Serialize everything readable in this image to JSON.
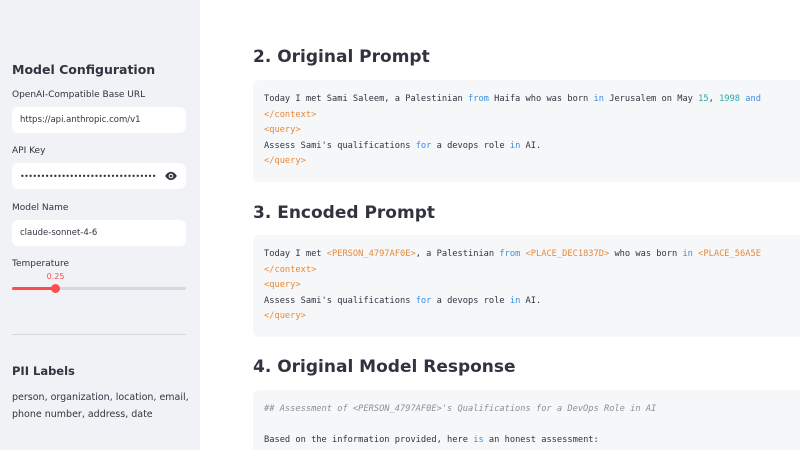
{
  "sidebar": {
    "heading": "Model Configuration",
    "base_url_label": "OpenAI-Compatible Base URL",
    "base_url_value": "https://api.anthropic.com/v1",
    "api_key_label": "API Key",
    "api_key_value": "••••••••••••••••••••••••••••••••••••••••••••••••••••",
    "model_label": "Model Name",
    "model_value": "claude-sonnet-4-6",
    "temperature_label": "Temperature",
    "temperature_value": "0.25",
    "temperature_fraction": 0.25,
    "pii_heading": "PII Labels",
    "pii_text": "person, organization, location, email, phone number, address, date",
    "accent_color": "#ff4b4b"
  },
  "main": {
    "original_prompt": {
      "title": "2. Original Prompt",
      "lines": [
        [
          {
            "t": "Today I met Sami Saleem, a Palestinian "
          },
          {
            "t": "from",
            "c": "kw"
          },
          {
            "t": " Haifa who was born "
          },
          {
            "t": "in",
            "c": "kw"
          },
          {
            "t": " Jerusalem on May "
          },
          {
            "t": "15",
            "c": "num"
          },
          {
            "t": ", "
          },
          {
            "t": "1998",
            "c": "num"
          },
          {
            "t": " and",
            "c": "kw"
          }
        ],
        [
          {
            "t": "</context>",
            "c": "tag"
          }
        ],
        [
          {
            "t": "<query>",
            "c": "tag"
          }
        ],
        [
          {
            "t": "Assess Sami's qualifications "
          },
          {
            "t": "for",
            "c": "kw"
          },
          {
            "t": " a devops role "
          },
          {
            "t": "in",
            "c": "kw"
          },
          {
            "t": " AI."
          }
        ],
        [
          {
            "t": "</query>",
            "c": "tag"
          }
        ]
      ]
    },
    "encoded_prompt": {
      "title": "3. Encoded Prompt",
      "lines": [
        [
          {
            "t": "Today I met "
          },
          {
            "t": "<PERSON_4797AF0E>",
            "c": "tag"
          },
          {
            "t": ", a Palestinian "
          },
          {
            "t": "from",
            "c": "kw"
          },
          {
            "t": " "
          },
          {
            "t": "<PLACE_DEC1837D>",
            "c": "tag"
          },
          {
            "t": " who was born "
          },
          {
            "t": "in",
            "c": "kw"
          },
          {
            "t": " "
          },
          {
            "t": "<PLACE_56A5E",
            "c": "tag"
          }
        ],
        [
          {
            "t": "</context>",
            "c": "tag"
          }
        ],
        [
          {
            "t": "<query>",
            "c": "tag"
          }
        ],
        [
          {
            "t": "Assess Sami's qualifications "
          },
          {
            "t": "for",
            "c": "kw"
          },
          {
            "t": " a devops role "
          },
          {
            "t": "in",
            "c": "kw"
          },
          {
            "t": " AI."
          }
        ],
        [
          {
            "t": "</query>",
            "c": "tag"
          }
        ]
      ]
    },
    "original_response": {
      "title": "4. Original Model Response",
      "lines": [
        [
          {
            "t": "## Assessment of <PERSON_4797AF0E>'s Qualifications for a DevOps Role in AI",
            "c": "cm"
          }
        ],
        [
          {
            "t": ""
          }
        ],
        [
          {
            "t": "Based on the information provided, here "
          },
          {
            "t": "is",
            "c": "kw"
          },
          {
            "t": " an honest assessment:"
          }
        ]
      ]
    }
  }
}
